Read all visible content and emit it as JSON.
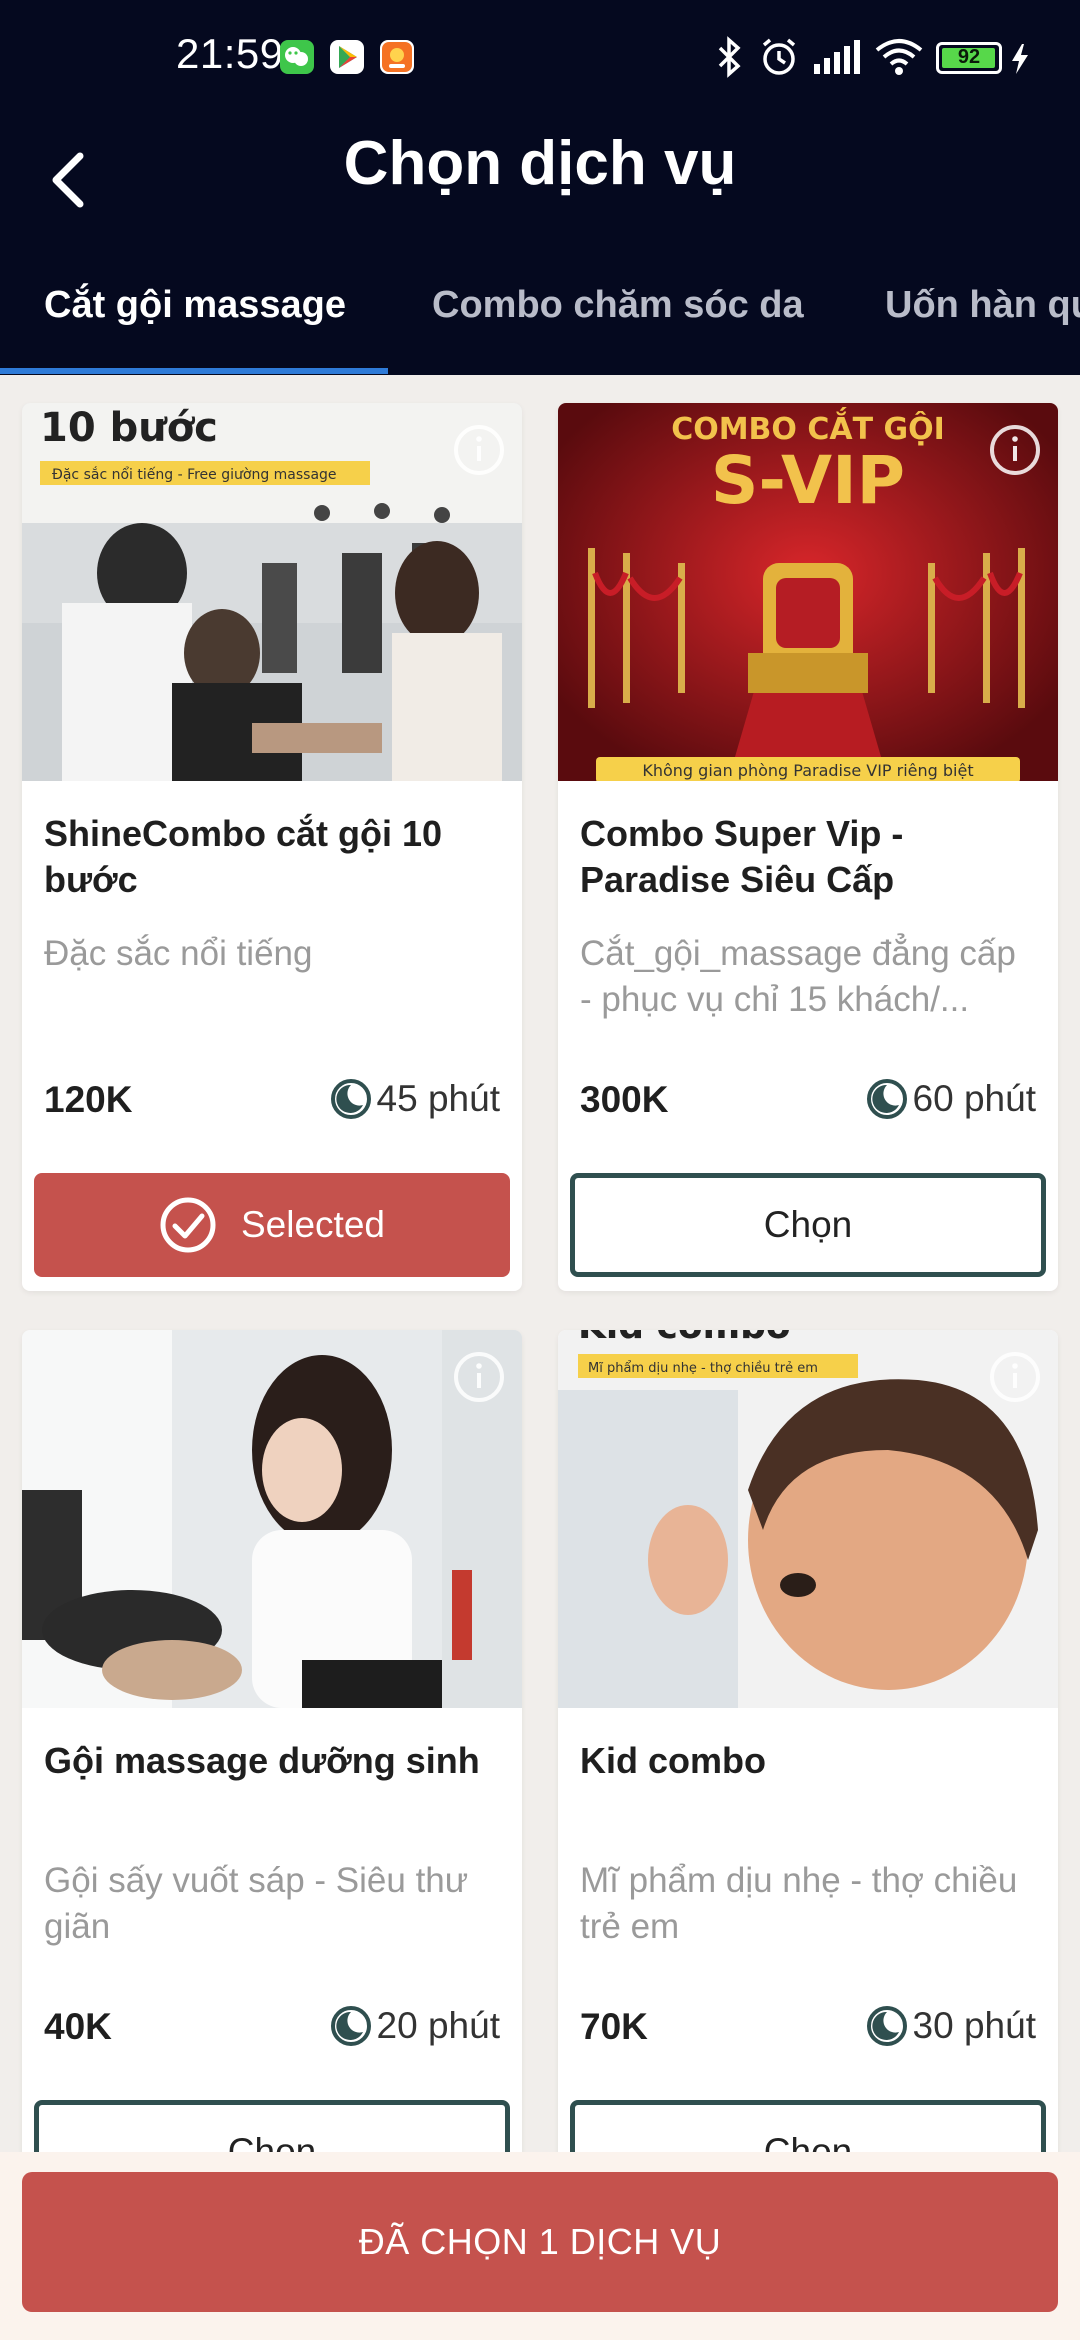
{
  "status_bar": {
    "time": "21:59",
    "battery": "92",
    "icons": [
      "wechat-icon",
      "play-store-icon",
      "shopee-icon",
      "bluetooth-icon",
      "alarm-icon",
      "signal-icon",
      "wifi-icon",
      "battery-icon",
      "charging-icon"
    ]
  },
  "header": {
    "title": "Chọn dịch vụ",
    "back_icon": "chevron-left-icon"
  },
  "tabs": [
    {
      "label": "Cắt gội massage",
      "active": true
    },
    {
      "label": "Combo chăm sóc da",
      "active": false
    },
    {
      "label": "Uốn hàn quốc",
      "active": false
    }
  ],
  "services": [
    {
      "image_caption": "10 bước",
      "image_badge": "Đặc sắc nổi tiếng - Free giường massage",
      "title": "ShineCombo cắt gội 10 bước",
      "description": "Đặc sắc nổi tiếng",
      "price": "120K",
      "duration": "45 phút",
      "button_label": "Selected",
      "selected": true
    },
    {
      "image_caption": "COMBO CẮT GỘI",
      "image_caption2": "S-VIP",
      "image_badge": "Không gian phòng Paradise VIP riêng biệt",
      "title": "Combo Super Vip - Paradise Siêu Cấp",
      "description": "Cắt_gội_massage đẳng cấp - phục vụ chỉ 15 khách/...",
      "price": "300K",
      "duration": "60 phút",
      "button_label": "Chọn",
      "selected": false
    },
    {
      "title": "Gội massage dưỡng sinh",
      "description": "Gội sấy vuốt sáp - Siêu thư giãn",
      "price": "40K",
      "duration": "20 phút",
      "button_label": "Chọn",
      "selected": false
    },
    {
      "image_caption": "Kid combo",
      "image_badge": "Mĩ phẩm dịu nhẹ - thợ chiều trẻ em",
      "title": "Kid combo",
      "description": "Mĩ phẩm dịu nhẹ - thợ chiều trẻ em",
      "price": "70K",
      "duration": "30 phút",
      "button_label": "Chọn",
      "selected": false
    }
  ],
  "bottom": {
    "confirm_label": "ĐÃ CHỌN 1 DỊCH VỤ"
  },
  "colors": {
    "header_bg": "#05091f",
    "accent_red": "#c5524d",
    "tab_indicator": "#2f7bd8",
    "button_border": "#2f4f4f",
    "badge_yellow": "#f6d04a"
  }
}
